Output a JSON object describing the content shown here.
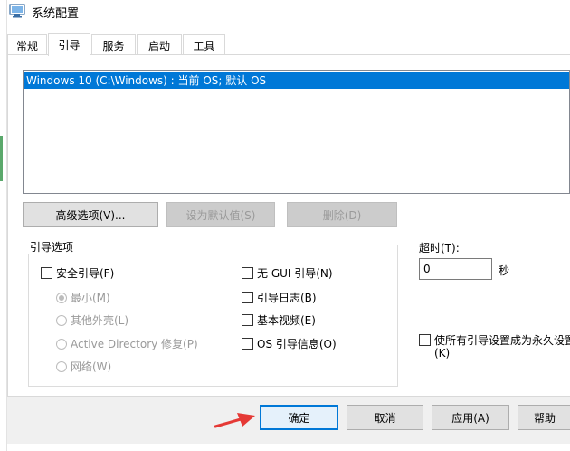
{
  "window": {
    "title": "系统配置",
    "icon": "system-config-icon"
  },
  "tabs": [
    {
      "label": "常规",
      "active": false
    },
    {
      "label": "引导",
      "active": true
    },
    {
      "label": "服务",
      "active": false
    },
    {
      "label": "启动",
      "active": false
    },
    {
      "label": "工具",
      "active": false
    }
  ],
  "os_list": {
    "items": [
      "Windows 10 (C:\\Windows) : 当前 OS; 默认 OS"
    ],
    "selected_index": 0
  },
  "buttons": {
    "advanced": "高级选项(V)...",
    "set_default": "设为默认值(S)",
    "delete": "删除(D)"
  },
  "boot_options": {
    "legend": "引导选项",
    "safe_boot": "安全引导(F)",
    "minimal": "最小(M)",
    "alternate_shell": "其他外壳(L)",
    "ad_repair": "Active Directory 修复(P)",
    "network": "网络(W)",
    "no_gui_boot": "无 GUI 引导(N)",
    "boot_log": "引导日志(B)",
    "base_video": "基本视频(E)",
    "os_boot_info": "OS 引导信息(O)"
  },
  "timeout": {
    "label": "超时(T):",
    "value": "0",
    "unit": "秒"
  },
  "permanent": {
    "line1": "使所有引导设置成为永久设置",
    "line2": "(K)"
  },
  "bottom_buttons": {
    "ok": "确定",
    "cancel": "取消",
    "apply": "应用(A)",
    "help": "帮助"
  },
  "colors": {
    "selection": "#0078d7",
    "annotation_arrow": "#e53935"
  }
}
